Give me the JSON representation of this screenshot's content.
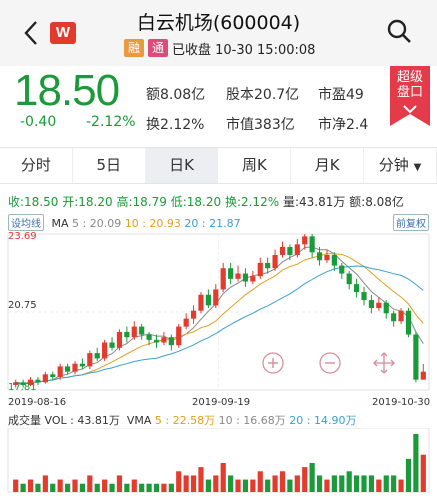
{
  "header": {
    "title": "白云机场(600004)",
    "logo": "W",
    "tag_rong": "融",
    "tag_tong": "通",
    "status": "已收盘 10-30 15:00:08"
  },
  "quote": {
    "price": "18.50",
    "change": "-0.40",
    "change_pct": "-2.12%",
    "amount_label": "额8.08亿",
    "equity_label": "股本20.7亿",
    "pe_label": "市盈49",
    "turnover_label": "换2.12%",
    "mcap_label": "市值383亿",
    "pb_label": "市净2.4"
  },
  "promo": {
    "line1": "超级",
    "line2": "盘口"
  },
  "tabs": [
    "分时",
    "5日",
    "日K",
    "周K",
    "月K",
    "分钟"
  ],
  "kline_info": {
    "close": "收:18.50",
    "open": "开:18.20",
    "high": "高:18.79",
    "low": "低:18.20",
    "turnover": "换:2.12%",
    "volume": "量:43.81万",
    "amount": "额:8.08亿"
  },
  "ma_line": {
    "set_label": "设均线",
    "ma_label": "MA",
    "ma5": "5 : 20.09",
    "ma10": "10 : 20.93",
    "ma20": "20 : 21.87",
    "adjust": "前复权"
  },
  "axis": {
    "y_top": "23.69",
    "y_mid": "20.75",
    "y_bottom": "17.81",
    "x1": "2019-08-16",
    "x2": "2019-09-19",
    "x3": "2019-10-30"
  },
  "volume_line": {
    "label": "成交量 VOL :",
    "vol": "43.81万",
    "vma_label": "VMA",
    "vma5": "5 : 22.58万",
    "vma10": "10 : 16.68万",
    "vma20": "20 : 14.90万"
  },
  "colors": {
    "up": "#e33b2e",
    "down": "#1a9a3a",
    "ma5": "#888888",
    "ma10": "#e0a020",
    "ma20": "#3aa0d0"
  },
  "chart_data": {
    "type": "candlestick",
    "ylim": [
      17.81,
      23.69
    ],
    "candles": [
      [
        18.0,
        18.1,
        17.9,
        18.2
      ],
      [
        18.1,
        18.0,
        17.9,
        18.2
      ],
      [
        18.0,
        18.2,
        17.95,
        18.3
      ],
      [
        18.2,
        18.1,
        18.0,
        18.3
      ],
      [
        18.1,
        18.4,
        18.05,
        18.5
      ],
      [
        18.4,
        18.3,
        18.2,
        18.5
      ],
      [
        18.3,
        18.7,
        18.2,
        18.8
      ],
      [
        18.7,
        18.5,
        18.4,
        18.8
      ],
      [
        18.5,
        18.8,
        18.4,
        18.9
      ],
      [
        18.8,
        18.7,
        18.6,
        19.0
      ],
      [
        18.7,
        19.2,
        18.6,
        19.3
      ],
      [
        19.2,
        19.0,
        18.9,
        19.4
      ],
      [
        19.0,
        19.6,
        18.9,
        19.7
      ],
      [
        19.6,
        19.4,
        19.3,
        19.8
      ],
      [
        19.4,
        20.0,
        19.3,
        20.1
      ],
      [
        20.0,
        19.8,
        19.6,
        20.2
      ],
      [
        19.8,
        20.2,
        19.7,
        20.4
      ],
      [
        20.2,
        19.9,
        19.7,
        20.3
      ],
      [
        19.9,
        19.7,
        19.5,
        20.0
      ],
      [
        19.7,
        19.6,
        19.4,
        19.9
      ],
      [
        19.6,
        19.8,
        19.5,
        20.0
      ],
      [
        19.8,
        19.5,
        19.3,
        19.9
      ],
      [
        19.5,
        20.2,
        19.4,
        20.3
      ],
      [
        20.2,
        20.5,
        20.1,
        20.7
      ],
      [
        20.5,
        20.8,
        20.3,
        21.0
      ],
      [
        20.8,
        21.4,
        20.7,
        21.5
      ],
      [
        21.4,
        21.0,
        20.9,
        21.6
      ],
      [
        21.0,
        21.6,
        20.9,
        21.8
      ],
      [
        21.6,
        22.4,
        21.5,
        22.6
      ],
      [
        22.4,
        22.0,
        21.8,
        22.6
      ],
      [
        22.0,
        22.2,
        21.9,
        22.5
      ],
      [
        22.2,
        21.9,
        21.7,
        22.4
      ],
      [
        21.9,
        22.1,
        21.8,
        22.3
      ],
      [
        22.1,
        22.6,
        22.0,
        22.8
      ],
      [
        22.6,
        22.4,
        22.2,
        22.8
      ],
      [
        22.4,
        22.9,
        22.3,
        23.1
      ],
      [
        22.9,
        23.2,
        22.8,
        23.4
      ],
      [
        23.2,
        22.9,
        22.7,
        23.3
      ],
      [
        22.9,
        23.3,
        22.8,
        23.5
      ],
      [
        23.3,
        23.6,
        23.1,
        23.69
      ],
      [
        23.6,
        23.0,
        22.8,
        23.69
      ],
      [
        23.0,
        22.7,
        22.5,
        23.2
      ],
      [
        22.7,
        22.9,
        22.6,
        23.1
      ],
      [
        22.9,
        22.5,
        22.3,
        23.0
      ],
      [
        22.5,
        22.2,
        22.0,
        22.6
      ],
      [
        22.2,
        21.8,
        21.6,
        22.3
      ],
      [
        21.8,
        21.5,
        21.3,
        22.0
      ],
      [
        21.5,
        21.2,
        21.0,
        21.7
      ],
      [
        21.2,
        20.9,
        20.7,
        21.4
      ],
      [
        20.9,
        21.1,
        20.8,
        21.3
      ],
      [
        21.1,
        20.7,
        20.5,
        21.2
      ],
      [
        20.7,
        20.4,
        20.2,
        20.8
      ],
      [
        20.4,
        20.8,
        20.3,
        20.9
      ],
      [
        20.8,
        19.9,
        19.8,
        20.9
      ],
      [
        19.9,
        18.2,
        18.1,
        20.0
      ],
      [
        18.2,
        18.5,
        18.2,
        18.79
      ]
    ],
    "volumes": [
      3,
      2,
      3,
      2,
      4,
      2,
      3,
      2,
      3,
      2,
      4,
      2,
      3,
      2,
      4,
      2,
      3,
      2,
      2,
      2,
      2,
      2,
      5,
      4,
      4,
      6,
      3,
      4,
      7,
      4,
      3,
      3,
      3,
      5,
      3,
      4,
      5,
      3,
      4,
      6,
      7,
      4,
      3,
      4,
      4,
      5,
      4,
      4,
      4,
      3,
      4,
      4,
      3,
      8,
      14,
      9
    ]
  }
}
